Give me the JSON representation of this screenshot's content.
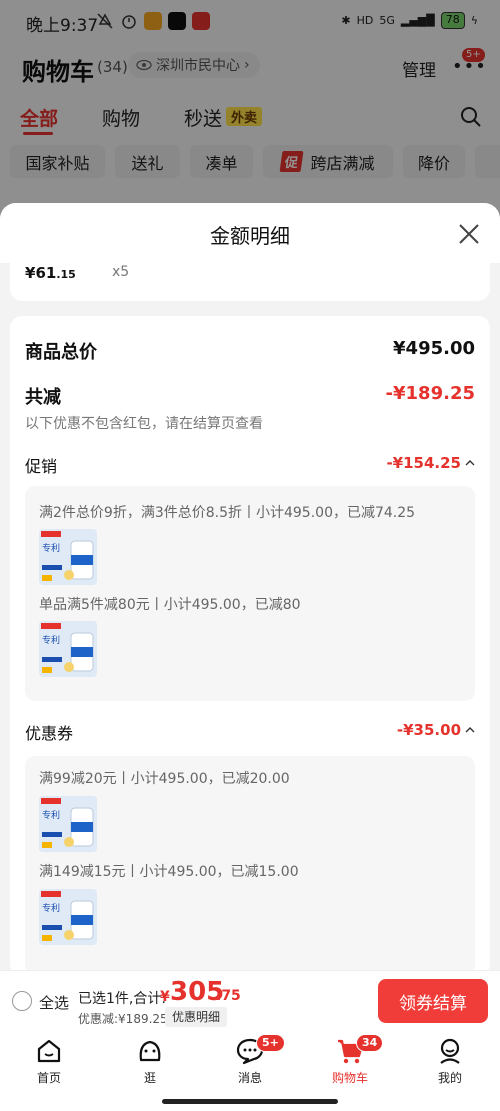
{
  "status_bar": {
    "time": "晚上9:37",
    "network": "5G",
    "battery": "78"
  },
  "cart": {
    "title": "购物车",
    "count": "(34)",
    "location": "深圳市民中心",
    "manage_label": "管理",
    "more_badge": "5+",
    "tabs": [
      {
        "label": "全部",
        "active": true
      },
      {
        "label": "购物",
        "active": false
      },
      {
        "label": "秒送",
        "active": false
      }
    ],
    "takeout_badge": "外卖",
    "filters": [
      "国家补贴",
      "送礼",
      "凑单",
      "跨店满减",
      "降价"
    ],
    "promo_tag": "促"
  },
  "sheet": {
    "title": "金额明细",
    "prev_item": {
      "price_symbol": "¥",
      "price_int": "61",
      "price_dec": ".15",
      "quantity": "x5"
    },
    "goods_total_label": "商品总价",
    "goods_total_value": "¥495.00",
    "reduction_label": "共减",
    "reduction_value": "-¥189.25",
    "reduction_note": "以下优惠不包含红包，请在结算页查看",
    "promotion": {
      "label": "促销",
      "value": "-¥154.25",
      "rules": [
        "满2件总价9折，满3件总价8.5折丨小计495.00，已减74.25",
        "单品满5件减80元丨小计495.00，已减80"
      ]
    },
    "coupon": {
      "label": "优惠券",
      "value": "-¥35.00",
      "rules": [
        "满99减20元丨小计495.00，已减20.00",
        "满149减15元丨小计495.00，已减15.00"
      ]
    }
  },
  "bottom_bar": {
    "select_all": "全选",
    "selected_text": "已选1件,合计:",
    "total_symbol": "¥",
    "total_int": "305",
    "total_dec": ".75",
    "discount_text": "优惠减:¥189.25",
    "detail_button": "优惠明细",
    "checkout_button": "领券结算"
  },
  "tabbar": {
    "items": [
      {
        "label": "首页",
        "icon": "home-icon"
      },
      {
        "label": "逛",
        "icon": "browse-icon"
      },
      {
        "label": "消息",
        "icon": "message-icon",
        "badge": "5+"
      },
      {
        "label": "购物车",
        "icon": "cart-icon",
        "badge": "34",
        "active": true
      },
      {
        "label": "我的",
        "icon": "profile-icon"
      }
    ]
  },
  "colors": {
    "accent": "#e5322d",
    "checkout": "#f03d3a",
    "takeout_badge": "#ffe24a"
  }
}
